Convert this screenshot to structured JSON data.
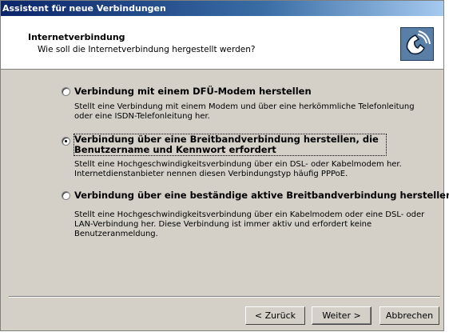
{
  "window": {
    "title": "Assistent für neue Verbindungen"
  },
  "header": {
    "title": "Internetverbindung",
    "subtitle": "Wie soll die Internetverbindung hergestellt werden?",
    "icon": "phone-handset-icon"
  },
  "options": [
    {
      "label": "Verbindung mit einem DFÜ-Modem herstellen",
      "description": "Stellt eine Verbindung mit einem Modem und über eine herkömmliche Telefonleitung oder eine ISDN-Telefonleitung her.",
      "selected": false
    },
    {
      "label": "Verbindung über eine Breitbandverbindung herstellen, die Benutzername und Kennwort erfordert",
      "description": "Stellt eine Hochgeschwindigkeitsverbindung über ein DSL- oder Kabelmodem her. Internetdienstanbieter nennen diesen Verbindungstyp häufig PPPoE.",
      "selected": true
    },
    {
      "label": "Verbindung über eine beständige aktive Breitbandverbindung herstellen",
      "description": "Stellt eine Hochgeschwindigkeitsverbindung über ein Kabelmodem oder eine DSL- oder LAN-Verbindung her. Diese Verbindung ist immer aktiv und erfordert keine Benutzeranmeldung.",
      "selected": false
    }
  ],
  "buttons": {
    "back": "< Zurück",
    "next": "Weiter >",
    "cancel": "Abbrechen"
  }
}
